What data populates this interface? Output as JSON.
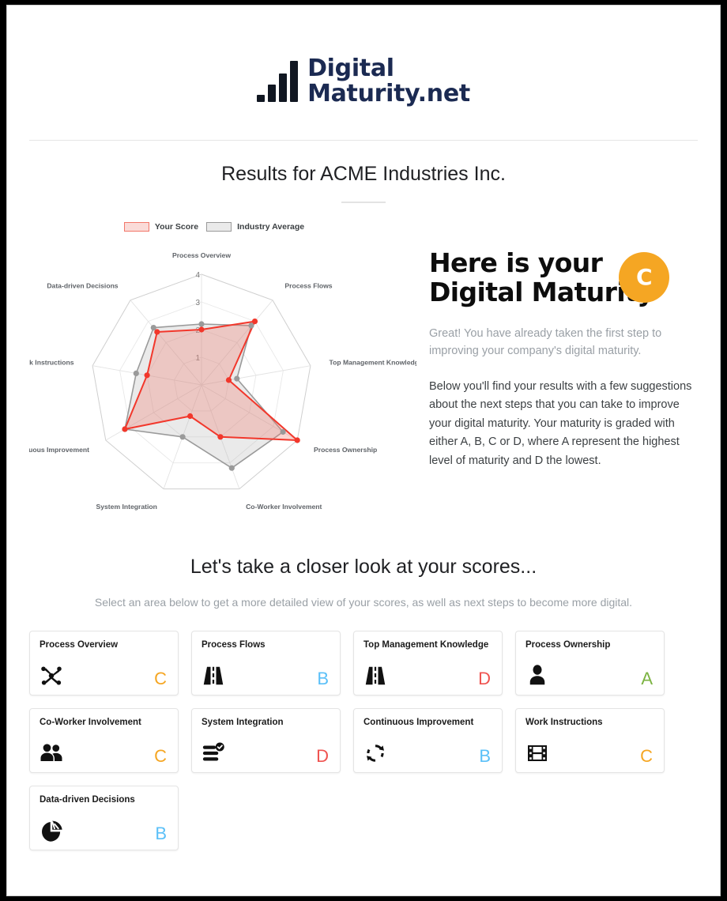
{
  "brand": {
    "name_line1": "Digital",
    "name_line2": "Maturity.net",
    "logo_icon": "bar-chart-logo-icon",
    "color": "#1b2a52"
  },
  "header": {
    "page_title": "Results for ACME Industries Inc."
  },
  "legend": {
    "your_score": "Your Score",
    "industry_average": "Industry Average",
    "your_score_color": "#f2776a",
    "industry_average_color": "#9a9a9a"
  },
  "maturity": {
    "heading_line1": "Here is your",
    "heading_line2": "Digital Maturity",
    "grade": "C",
    "grade_color": "#f5a623",
    "lead": "Great! You have already taken the first step to improving your company's digital maturity.",
    "body": "Below you'll find your results with a few suggestions about the next steps that you can take to improve your digital maturity. Your maturity is graded with either A, B, C or D, where A represent the highest level of maturity and D the lowest."
  },
  "closer": {
    "heading": "Let's take a closer look at your scores...",
    "subtitle": "Select an area below to get a more detailed view of your scores, as well as next steps to become more digital."
  },
  "cards": [
    {
      "title": "Process Overview",
      "grade": "C",
      "color": "#f5a623",
      "icon": "project-hub-icon"
    },
    {
      "title": "Process Flows",
      "grade": "B",
      "color": "#5bc0f8",
      "icon": "road-icon"
    },
    {
      "title": "Top Management Knowledge",
      "grade": "D",
      "color": "#ef5350",
      "icon": "road-icon"
    },
    {
      "title": "Process Ownership",
      "grade": "A",
      "color": "#7cb342",
      "icon": "user-tie-icon"
    },
    {
      "title": "Co-Worker Involvement",
      "grade": "C",
      "color": "#f5a623",
      "icon": "users-icon"
    },
    {
      "title": "System Integration",
      "grade": "D",
      "color": "#ef5350",
      "icon": "tasks-check-icon"
    },
    {
      "title": "Continuous Improvement",
      "grade": "B",
      "color": "#5bc0f8",
      "icon": "sync-icon"
    },
    {
      "title": "Work Instructions",
      "grade": "C",
      "color": "#f5a623",
      "icon": "film-icon"
    },
    {
      "title": "Data-driven Decisions",
      "grade": "B",
      "color": "#5bc0f8",
      "icon": "chart-pie-icon"
    }
  ],
  "chart_data": {
    "type": "radar",
    "title": "",
    "categories": [
      "Process Overview",
      "Process Flows",
      "Top Management Knowledge",
      "Process Ownership",
      "Co-Worker Involvement",
      "System Integration",
      "Continuous Improvement",
      "Work Instructions",
      "Data-driven Decisions"
    ],
    "tick_labels": [
      "1",
      "2",
      "3",
      "4"
    ],
    "rlim": [
      0,
      4
    ],
    "grid": true,
    "legend_position": "top",
    "series": [
      {
        "name": "Your Score",
        "color": "#f2372b",
        "fill": "rgba(242,119,106,0.30)",
        "values": [
          2.0,
          3.0,
          1.0,
          4.0,
          2.0,
          1.2,
          3.2,
          2.0,
          2.5
        ]
      },
      {
        "name": "Industry Average",
        "color": "#9a9a9a",
        "fill": "rgba(170,170,170,0.25)",
        "values": [
          2.2,
          2.8,
          1.3,
          3.4,
          3.2,
          2.0,
          3.2,
          2.4,
          2.7
        ]
      }
    ]
  }
}
